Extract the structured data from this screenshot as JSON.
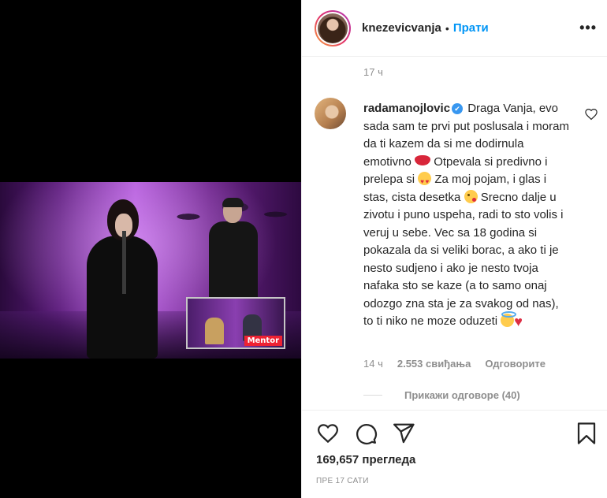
{
  "header": {
    "username": "knezevicvanja",
    "separator": "•",
    "follow_label": "Прати",
    "more_label": "•••"
  },
  "post": {
    "caption_age": "17 ч"
  },
  "comment": {
    "username": "radamanojlovic",
    "verified_mark": "✔",
    "text_1": " Draga Vanja, evo sada sam te prvi put poslusala i moram da ti kazem da si me dodirnula emotivno ",
    "text_2": " Otpevala si predivno i prelepa si ",
    "text_3": " Za moj pojam, i glas i stas, cista desetka ",
    "text_4": " Srecno dalje u zivotu i puno uspeha, radi to sto volis i veruj u sebe. Vec sa 18 godina si pokazala da si veliki borac, a ako ti je nesto sudjeno i ako je nesto tvoja nafaka sto se kaze (a to samo onaj odozgo zna sta je za svakog od nas), to ti niko ne moze oduzeti ",
    "heart_glyph": "♥",
    "age": "14 ч",
    "likes": "2.553 свиђања",
    "reply_label": "Одговорите",
    "view_replies": "Прикажи одговоре (40)"
  },
  "footer": {
    "views": "169,657 прегледа",
    "time": "ПРЕ 17 САТИ"
  },
  "video": {
    "overlay_label": "Mentor"
  },
  "colors": {
    "accent": "#0095f6",
    "verified": "#3897f0",
    "muted": "#8e8e8e",
    "text": "#262626"
  }
}
